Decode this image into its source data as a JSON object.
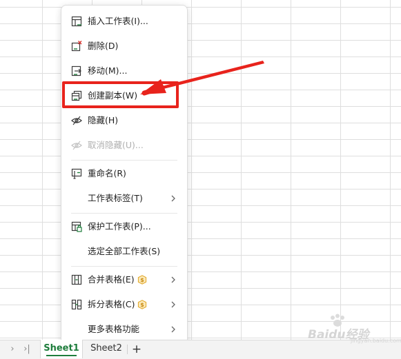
{
  "menu": {
    "items": [
      {
        "label": "插入工作表(I)...",
        "icon": "insert-sheet-icon",
        "disabled": false
      },
      {
        "label": "删除(D)",
        "icon": "delete-sheet-icon",
        "disabled": false
      },
      {
        "label": "移动(M)...",
        "icon": "move-sheet-icon",
        "disabled": false
      },
      {
        "label": "创建副本(W)",
        "icon": "copy-sheet-icon",
        "disabled": false
      },
      {
        "label": "隐藏(H)",
        "icon": "hide-icon",
        "disabled": false
      },
      {
        "label": "取消隐藏(U)...",
        "icon": "unhide-icon",
        "disabled": true
      },
      {
        "label": "重命名(R)",
        "icon": "rename-icon",
        "disabled": false
      },
      {
        "label": "工作表标签(T)",
        "icon": "",
        "disabled": false,
        "submenu": true
      },
      {
        "label": "保护工作表(P)...",
        "icon": "protect-sheet-icon",
        "disabled": false
      },
      {
        "label": "选定全部工作表(S)",
        "icon": "",
        "disabled": false
      },
      {
        "label": "合并表格(E)",
        "icon": "merge-table-icon",
        "disabled": false,
        "submenu": true,
        "premium": true
      },
      {
        "label": "拆分表格(C)",
        "icon": "split-table-icon",
        "disabled": false,
        "submenu": true,
        "premium": true
      },
      {
        "label": "更多表格功能",
        "icon": "",
        "disabled": false,
        "submenu": true
      }
    ]
  },
  "tabs": {
    "active": "Sheet1",
    "sheet1": "Sheet1",
    "sheet2": "Sheet2",
    "add": "+"
  },
  "nav": {
    "next": "›",
    "last": "›|"
  },
  "watermark": {
    "text": "Baidu经验",
    "sub": "jingyan.baidu.com"
  },
  "colors": {
    "accent": "#1e7d3c",
    "annotation": "#e8231c",
    "premium": "#e0a524"
  }
}
